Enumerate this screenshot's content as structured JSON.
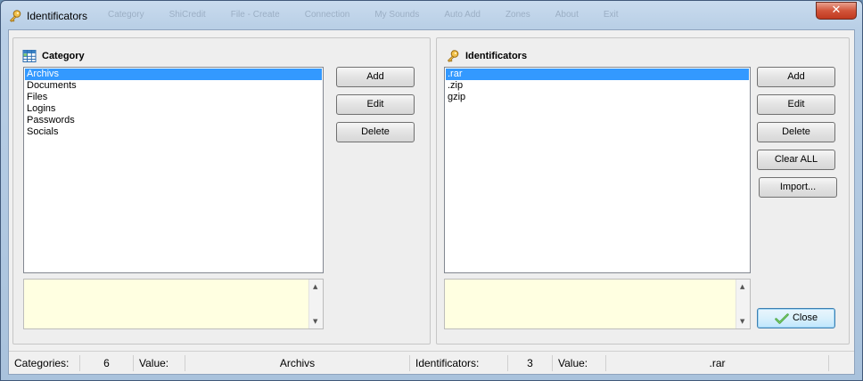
{
  "window": {
    "title": "Identificators",
    "close_glyph": "✕",
    "background_menu_ghost": [
      "Category",
      "ShiCredit",
      "File - Create",
      "Connection",
      "My Sounds",
      "Auto Add",
      "Zones",
      "About",
      "Exit"
    ]
  },
  "category_panel": {
    "title": "Category",
    "icon": "table-icon",
    "items": [
      "Archivs",
      "Documents",
      "Files",
      "Logins",
      "Passwords",
      "Socials"
    ],
    "selected_index": 0,
    "buttons": {
      "add": "Add",
      "edit": "Edit",
      "delete": "Delete"
    },
    "memo_text": ""
  },
  "identificators_panel": {
    "title": "Identificators",
    "icon": "key-icon",
    "items": [
      ".rar",
      ".zip",
      "gzip"
    ],
    "selected_index": 0,
    "buttons": {
      "add": "Add",
      "edit": "Edit",
      "delete": "Delete",
      "clear_all": "Clear ALL",
      "import": "Import..."
    },
    "memo_text": ""
  },
  "close_button": {
    "label": "Close",
    "icon": "checkmark-icon"
  },
  "statusbar": {
    "categories_label": "Categories:",
    "categories_count": "6",
    "value1_label": "Value:",
    "value1": "Archivs",
    "identificators_label": "Identificators:",
    "identificators_count": "3",
    "value2_label": "Value:",
    "value2": ".rar"
  },
  "colors": {
    "selection": "#3399ff",
    "memo_background": "#ffffe1",
    "close_window_button": "#c9442a"
  }
}
